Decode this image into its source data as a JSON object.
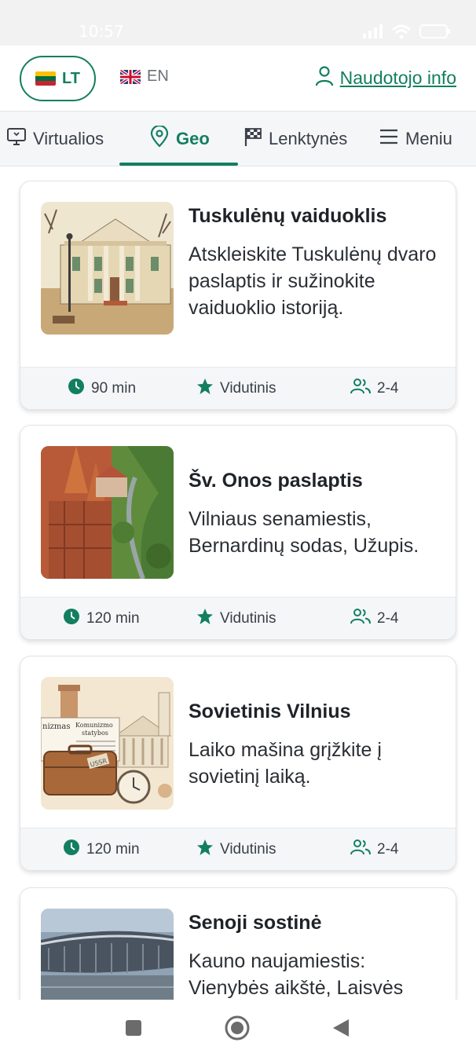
{
  "status_bar": {
    "time": "10:57"
  },
  "header": {
    "lang_lt": "LT",
    "lang_en": "EN",
    "user_info": "Naudotojo info"
  },
  "tabs": [
    {
      "label": "Virtualios",
      "icon": "monitor-icon"
    },
    {
      "label": "Geo",
      "icon": "location-pin-icon",
      "active": true
    },
    {
      "label": "Lenktynės",
      "icon": "checkered-flag-icon"
    },
    {
      "label": "Meniu",
      "icon": "hamburger-menu-icon"
    }
  ],
  "colors": {
    "accent": "#127f5f",
    "tab_bg": "#f4f6f8",
    "status_bg": "#f2f2f2"
  },
  "tours": [
    {
      "title": "Tuskulėnų vaiduoklis",
      "description": "Atskleiskite Tuskulėnų dvaro paslaptis ir sužinokite vaiduoklio istoriją.",
      "duration": "90 min",
      "difficulty": "Vidutinis",
      "players": "2-4"
    },
    {
      "title": "Šv. Onos paslaptis",
      "description": "Vilniaus senamiestis, Bernardinų sodas, Užupis.",
      "duration": "120 min",
      "difficulty": "Vidutinis",
      "players": "2-4"
    },
    {
      "title": "Sovietinis Vilnius",
      "description": "Laiko mašina grįžkite į sovietinį laiką.",
      "duration": "120 min",
      "difficulty": "Vidutinis",
      "players": "2-4",
      "image_text": [
        "nizmas",
        "Komunizmo",
        "statybos",
        "USSR"
      ]
    },
    {
      "title": "Senoji sostinė",
      "description": "Kauno naujamiestis: Vienybės aikštė, Laisvės"
    }
  ]
}
